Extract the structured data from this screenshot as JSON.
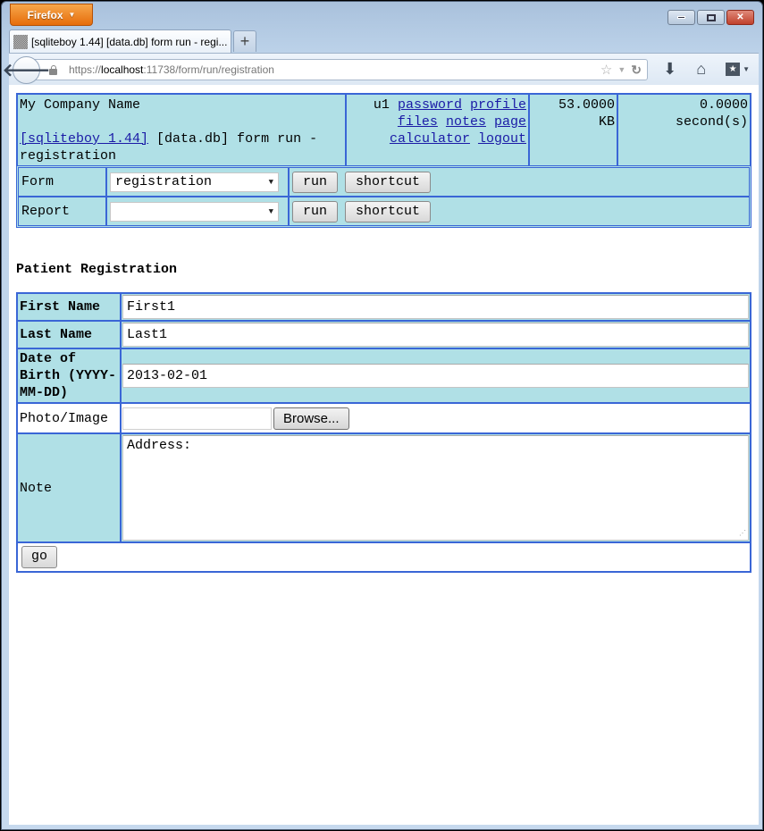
{
  "browser": {
    "app_button": "Firefox",
    "tab_title": "[sqliteboy 1.44] [data.db] form run - regi...",
    "url_scheme": "https://",
    "url_host": "localhost",
    "url_rest": ":11738/form/run/registration",
    "new_tab_label": "+"
  },
  "header": {
    "company": "My Company Name",
    "app_link": "[sqliteboy 1.44]",
    "context": "[data.db] form run - registration",
    "user": "u1",
    "links": [
      "password",
      "profile",
      "files",
      "notes",
      "page",
      "calculator",
      "logout"
    ],
    "memory_value": "53.0000",
    "memory_unit": "KB",
    "time_value": "0.0000",
    "time_unit": "second(s)"
  },
  "runbox": {
    "rows": [
      {
        "label": "Form",
        "selected": "registration",
        "run_label": "run",
        "shortcut_label": "shortcut"
      },
      {
        "label": "Report",
        "selected": "",
        "run_label": "run",
        "shortcut_label": "shortcut"
      }
    ]
  },
  "form": {
    "title": "Patient Registration",
    "fields": {
      "first_name": {
        "label": "First Name",
        "value": "First1"
      },
      "last_name": {
        "label": "Last Name",
        "value": "Last1"
      },
      "dob": {
        "label": "Date of Birth (YYYY-MM-DD)",
        "value": "2013-02-01"
      },
      "photo": {
        "label": "Photo/Image",
        "browse_label": "Browse..."
      },
      "note": {
        "label": "Note",
        "value": "Address:"
      }
    },
    "submit_label": "go"
  },
  "colors": {
    "panel_bg": "#b0e0e6",
    "border": "#3a66d6",
    "link": "#1a1aa6"
  }
}
